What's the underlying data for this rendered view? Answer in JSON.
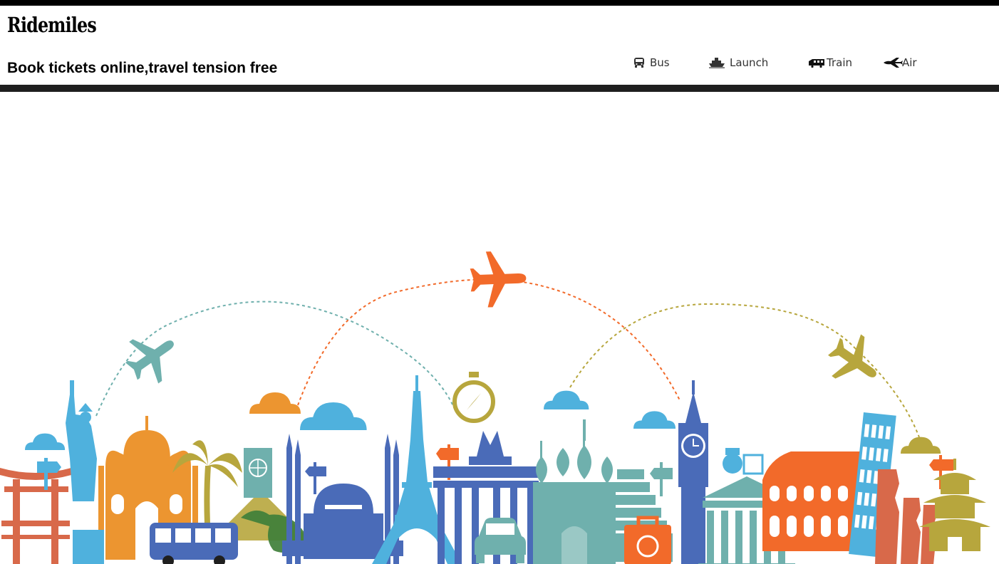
{
  "brand": {
    "name": "Ridemiles"
  },
  "tagline": "Book tickets online,travel tension free",
  "nav": {
    "items": [
      {
        "label": "Bus",
        "icon": "bus-icon"
      },
      {
        "label": "Launch",
        "icon": "ship-icon"
      },
      {
        "label": "Train",
        "icon": "train-icon"
      },
      {
        "label": "Air",
        "icon": "airplane-icon"
      }
    ]
  },
  "hero": {
    "illustration": "world-landmarks-travel-skyline"
  },
  "colors": {
    "orange": "#f26a2a",
    "amber": "#ec9530",
    "sky": "#4fb1dd",
    "teal": "#6fb0ad",
    "olive": "#b7a63d",
    "navy": "#4a6bb8",
    "brick": "#d8694a",
    "dark": "#1f1f1f"
  }
}
